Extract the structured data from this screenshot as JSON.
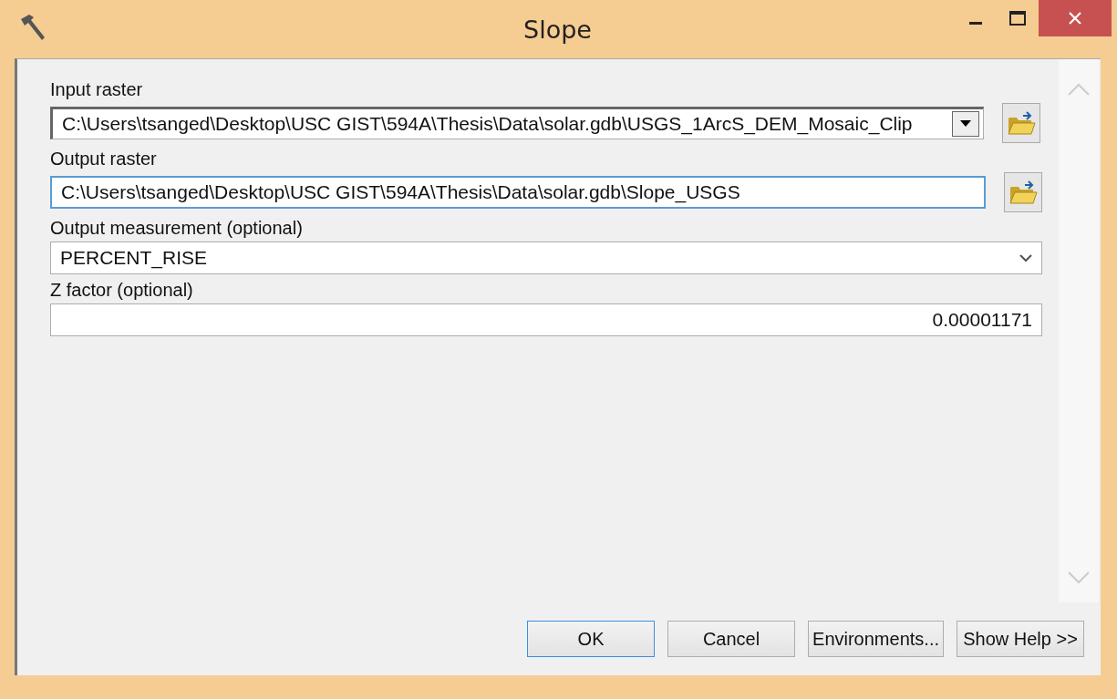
{
  "window": {
    "title": "Slope"
  },
  "fields": [
    {
      "label": "Input raster",
      "kind": "combo",
      "value": "C:\\Users\\tsanged\\Desktop\\USC GIST\\594A\\Thesis\\Data\\solar.gdb\\USGS_1ArcS_DEM_Mosaic_Clip",
      "focused": false,
      "browse": true
    },
    {
      "label": "Output raster",
      "kind": "text",
      "value": "C:\\Users\\tsanged\\Desktop\\USC GIST\\594A\\Thesis\\Data\\solar.gdb\\Slope_USGS",
      "focused": true,
      "browse": true
    },
    {
      "label": "Output measurement (optional)",
      "kind": "dropdown",
      "value": "PERCENT_RISE",
      "focused": false,
      "browse": false
    },
    {
      "label": "Z factor (optional)",
      "kind": "number",
      "value": "0.00001171",
      "focused": false,
      "browse": false
    }
  ],
  "buttons": [
    {
      "label": "OK",
      "default": true
    },
    {
      "label": "Cancel",
      "default": false
    },
    {
      "label": "Environments...",
      "default": false
    },
    {
      "label": "Show Help >>",
      "default": false
    }
  ]
}
